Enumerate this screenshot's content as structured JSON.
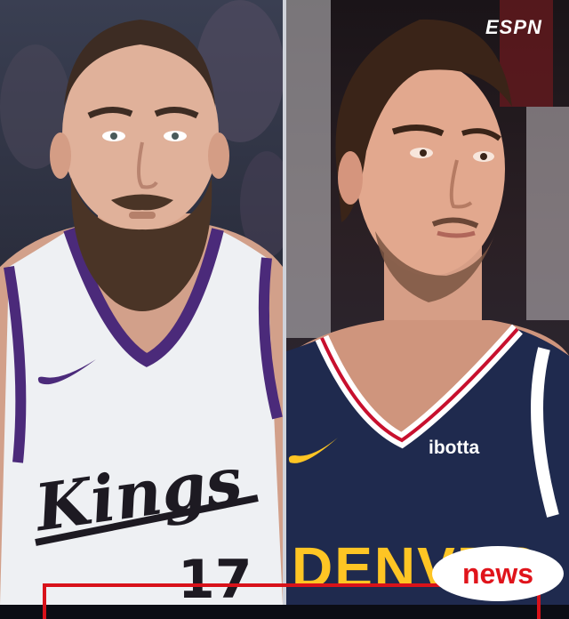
{
  "logo": {
    "text": "ESPN"
  },
  "left_player": {
    "jersey_wordmark": "Kings",
    "jersey_number": "17",
    "palette": {
      "jersey": "#eef0f3",
      "trim": "#4b2a7a"
    }
  },
  "right_player": {
    "sponsor_text": "ibotta",
    "jersey_wordmark": "DENVER",
    "palette": {
      "jersey": "#1f2a4e",
      "trim": "#c8102e",
      "accent": "#fec524"
    }
  },
  "badge": {
    "text": "news",
    "color": "#e0141b"
  }
}
